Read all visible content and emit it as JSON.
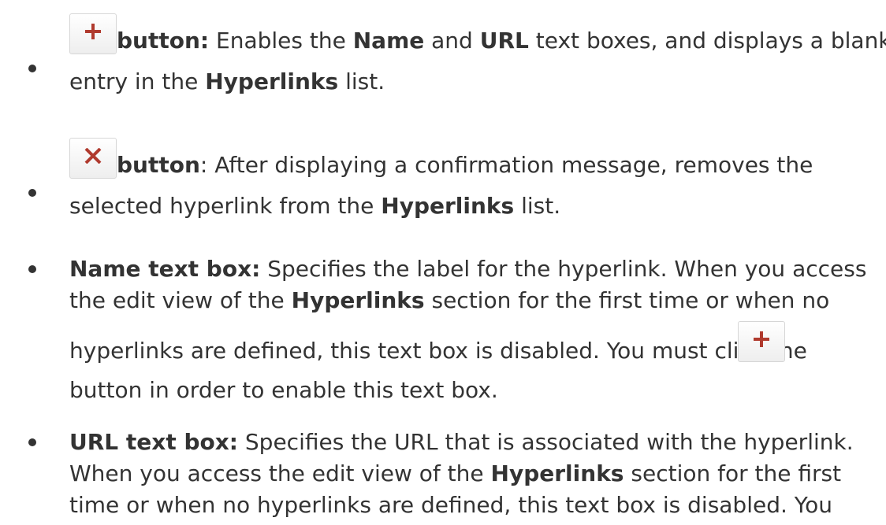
{
  "colors": {
    "text": "#333333",
    "icon_red": "#b03a2e",
    "button_border": "#d6d6d6"
  },
  "icons": {
    "add": "plus-icon",
    "delete": "x-icon"
  },
  "items": [
    {
      "button_word": "button:",
      "t1": " Enables the ",
      "name": "Name",
      "t2": " and ",
      "url": "URL",
      "t3": " text boxes, and displays a blank",
      "line2a": "entry in the ",
      "hyperlinks": "Hyperlinks",
      "line2b": " list."
    },
    {
      "button_word": "button",
      "t1": ": After displaying a confirmation message, removes the",
      "line2a": "selected hyperlink from the ",
      "hyperlinks": "Hyperlinks",
      "line2b": " list."
    },
    {
      "label": "Name text box:",
      "t1": " Specifies the label for the hyperlink. When you access",
      "line2a": "the edit view of the ",
      "hyperlinks": "Hyperlinks",
      "line2b": " section for the first time or when no",
      "line3": "hyperlinks are defined, this text box is disabled. You must click the",
      "line4": "button in order to enable this text box."
    },
    {
      "label": "URL text box:",
      "t1": " Specifies the URL that is associated with the hyperlink.",
      "line2a": "When you access the edit view of the ",
      "hyperlinks": "Hyperlinks",
      "line2b": " section for the first",
      "line3": "time or when no hyperlinks are defined, this text box is disabled. You"
    }
  ]
}
